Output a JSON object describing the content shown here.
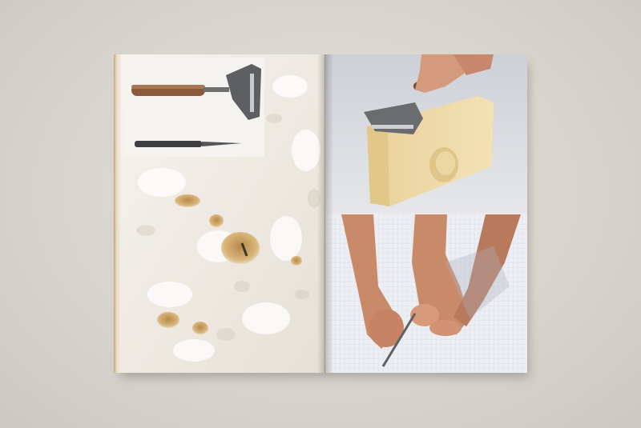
{
  "photo": {
    "subject": "open-booklet",
    "colors": {
      "table": "#d9d7d0",
      "cheese_white": "#f1eee8",
      "cheese_block": "#ecd9a6",
      "skin": "#c98a6a",
      "backdrop_grey": "#d4d6dc",
      "tile_blue": "#e8eaf0"
    },
    "icons": [
      "cheese-slicer-icon",
      "scalpel-icon"
    ]
  }
}
